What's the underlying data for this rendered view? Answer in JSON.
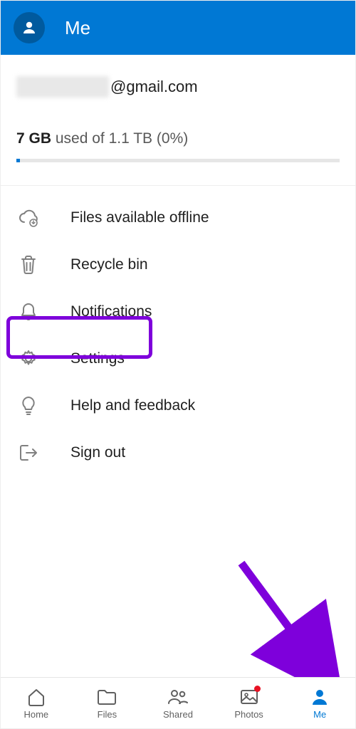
{
  "header": {
    "title": "Me"
  },
  "account": {
    "email_suffix": "@gmail.com"
  },
  "storage": {
    "used": "7 GB",
    "middle": " used of ",
    "total": "1.1 TB",
    "percent": " (0%)"
  },
  "menu": {
    "offline": "Files available offline",
    "recycle": "Recycle bin",
    "notifications": "Notifications",
    "settings": "Settings",
    "help": "Help and feedback",
    "signout": "Sign out"
  },
  "nav": {
    "home": "Home",
    "files": "Files",
    "shared": "Shared",
    "photos": "Photos",
    "me": "Me"
  },
  "colors": {
    "brand": "#0078d4",
    "highlight": "#7e00db"
  }
}
